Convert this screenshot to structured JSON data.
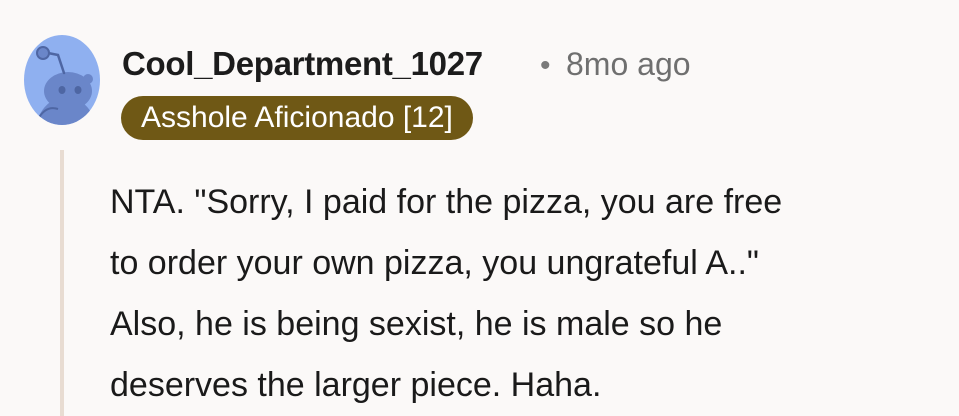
{
  "comment": {
    "author": "Cool_Department_1027",
    "separator": "•",
    "timestamp": "8mo ago",
    "flair": "Asshole Aficionado [12]",
    "body_lines": [
      "NTA. \"Sorry, I paid for the pizza, you are free",
      "to order your own pizza, you ungrateful A..\"",
      "Also, he is being sexist, he is male so he",
      "deserves the larger piece. Haha."
    ]
  },
  "icons": {
    "avatar": "snoo-avatar-icon"
  },
  "colors": {
    "background": "#fbf9f8",
    "flair_background": "#6f5815",
    "flair_text": "#ffffff",
    "avatar_background": "#8fb0f0",
    "avatar_figure": "#6a86c9",
    "thread_line": "#e8dcd2"
  }
}
